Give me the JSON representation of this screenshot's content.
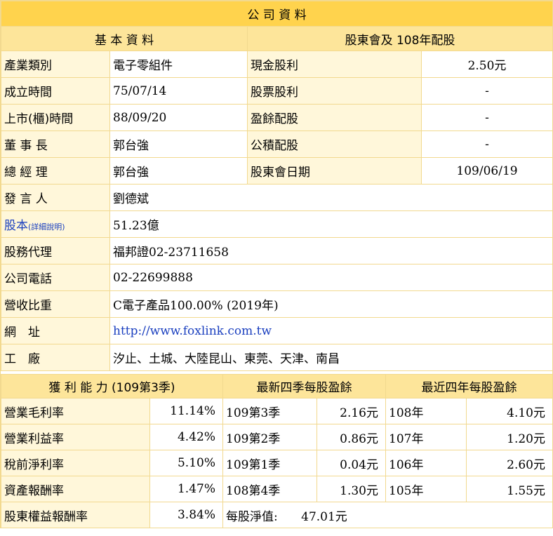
{
  "title": "公 司 資 料",
  "basic": {
    "header": "基 本 資 料",
    "rows": [
      {
        "label": "產業類別",
        "value": "電子零組件"
      },
      {
        "label": "成立時間",
        "value": "75/07/14"
      },
      {
        "label": "上市(櫃)時間",
        "value": "88/09/20"
      },
      {
        "label": "董 事 長",
        "value": "郭台強"
      },
      {
        "label": "總 經 理",
        "value": "郭台強"
      },
      {
        "label": "發 言 人",
        "value": "劉德斌"
      },
      {
        "label": "股本",
        "label_link": "(詳細說明)",
        "value": "51.23億"
      },
      {
        "label": "股務代理",
        "value": "福邦證02-23711658"
      },
      {
        "label": "公司電話",
        "value": "02-22699888"
      },
      {
        "label": "營收比重",
        "value": "C電子產品100.00% (2019年)"
      },
      {
        "label": "網　址",
        "value": "http://www.foxlink.com.tw"
      },
      {
        "label": "工　廠",
        "value": "汐止、土城、大陸昆山、東莞、天津、南昌"
      }
    ]
  },
  "dividend": {
    "header": "股東會及 108年配股",
    "rows": [
      {
        "label": "現金股利",
        "value": "2.50元"
      },
      {
        "label": "股票股利",
        "value": "-"
      },
      {
        "label": "盈餘配股",
        "value": "-"
      },
      {
        "label": "公積配股",
        "value": "-"
      },
      {
        "label": "股東會日期",
        "value": "109/06/19"
      }
    ]
  },
  "profit": {
    "header": "獲 利 能 力 (109第3季)",
    "rows": [
      {
        "label": "營業毛利率",
        "value": "11.14%"
      },
      {
        "label": "營業利益率",
        "value": "4.42%"
      },
      {
        "label": "稅前淨利率",
        "value": "5.10%"
      },
      {
        "label": "資產報酬率",
        "value": "1.47%"
      },
      {
        "label": "股東權益報酬率",
        "value": "3.84%"
      }
    ]
  },
  "quarter_eps": {
    "header": "最新四季每股盈餘",
    "rows": [
      {
        "label": "109第3季",
        "value": "2.16元"
      },
      {
        "label": "109第2季",
        "value": "0.86元"
      },
      {
        "label": "109第1季",
        "value": "0.04元"
      },
      {
        "label": "108第4季",
        "value": "1.30元"
      }
    ]
  },
  "annual_eps": {
    "header": "最近四年每股盈餘",
    "rows": [
      {
        "label": "108年",
        "value": "4.10元"
      },
      {
        "label": "107年",
        "value": "1.20元"
      },
      {
        "label": "106年",
        "value": "2.60元"
      },
      {
        "label": "105年",
        "value": "1.55元"
      }
    ]
  },
  "nav": {
    "label": "每股淨值:",
    "value": "47.01元"
  },
  "colors": {
    "header_bg": "#ffd34d",
    "subheader_bg": "#fde59a",
    "label_bg": "#fff7da",
    "border": "#f2d98f",
    "link": "#1a3fbf"
  }
}
